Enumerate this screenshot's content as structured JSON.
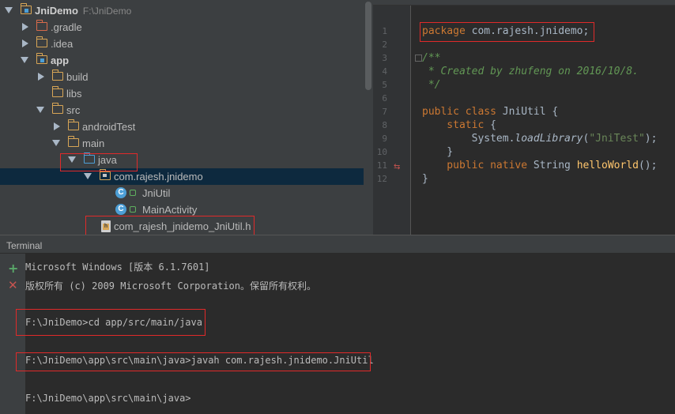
{
  "project": {
    "root": {
      "name": "JniDemo",
      "path": "F:\\JniDemo"
    },
    "items": {
      "gradle": ".gradle",
      "idea": ".idea",
      "app": "app",
      "build": "build",
      "libs": "libs",
      "src": "src",
      "androidTest": "androidTest",
      "main": "main",
      "java": "java",
      "package": "com.rajesh.jnidemo",
      "jniutil": "JniUtil",
      "mainactivity": "MainActivity",
      "header": "com_rajesh_jnidemo_JniUtil.h"
    }
  },
  "editor": {
    "line_numbers": [
      "1",
      "2",
      "3",
      "4",
      "5",
      "6",
      "7",
      "8",
      "9",
      "10",
      "11",
      "12"
    ],
    "lines": {
      "l1_kw": "package",
      "l1_pkg": " com.rajesh.",
      "l1_pkg2": "jnidemo",
      "l1_end": ";",
      "l3": "/**",
      "l4": " * Created by zhufeng on 2016/10/8.",
      "l5": " */",
      "l7_kw1": "public",
      "l7_kw2": " class",
      "l7_rest": " JniUtil {",
      "l8_kw": "    static",
      "l8_rest": " {",
      "l9_a": "        System.",
      "l9_b": "loadLibrary",
      "l9_c": "(",
      "l9_d": "\"JniTest\"",
      "l9_e": ");",
      "l10": "    }",
      "l11_kw1": "    public",
      "l11_kw2": " native",
      "l11_a": " String ",
      "l11_fn": "helloWorld",
      "l11_b": "();",
      "l12": "}"
    }
  },
  "terminal": {
    "title": "Terminal",
    "lines": [
      "Microsoft Windows [版本 6.1.7601]",
      "版权所有 (c) 2009 Microsoft Corporation。保留所有权利。",
      "F:\\JniDemo>cd app/src/main/java",
      "F:\\JniDemo\\app\\src\\main\\java>javah com.rajesh.jnidemo.JniUtil",
      "F:\\JniDemo\\app\\src\\main\\java>"
    ]
  },
  "colors": {
    "annotation_box": "#e02a2a",
    "selection": "#0d293e",
    "keyword": "#cc7832",
    "comment": "#629755",
    "string": "#6a8759",
    "method": "#ffc66d"
  },
  "icons": [
    "folder-icon",
    "package-icon",
    "class-icon",
    "lock-icon",
    "header-file-icon",
    "add-icon",
    "close-icon",
    "override-icon"
  ]
}
